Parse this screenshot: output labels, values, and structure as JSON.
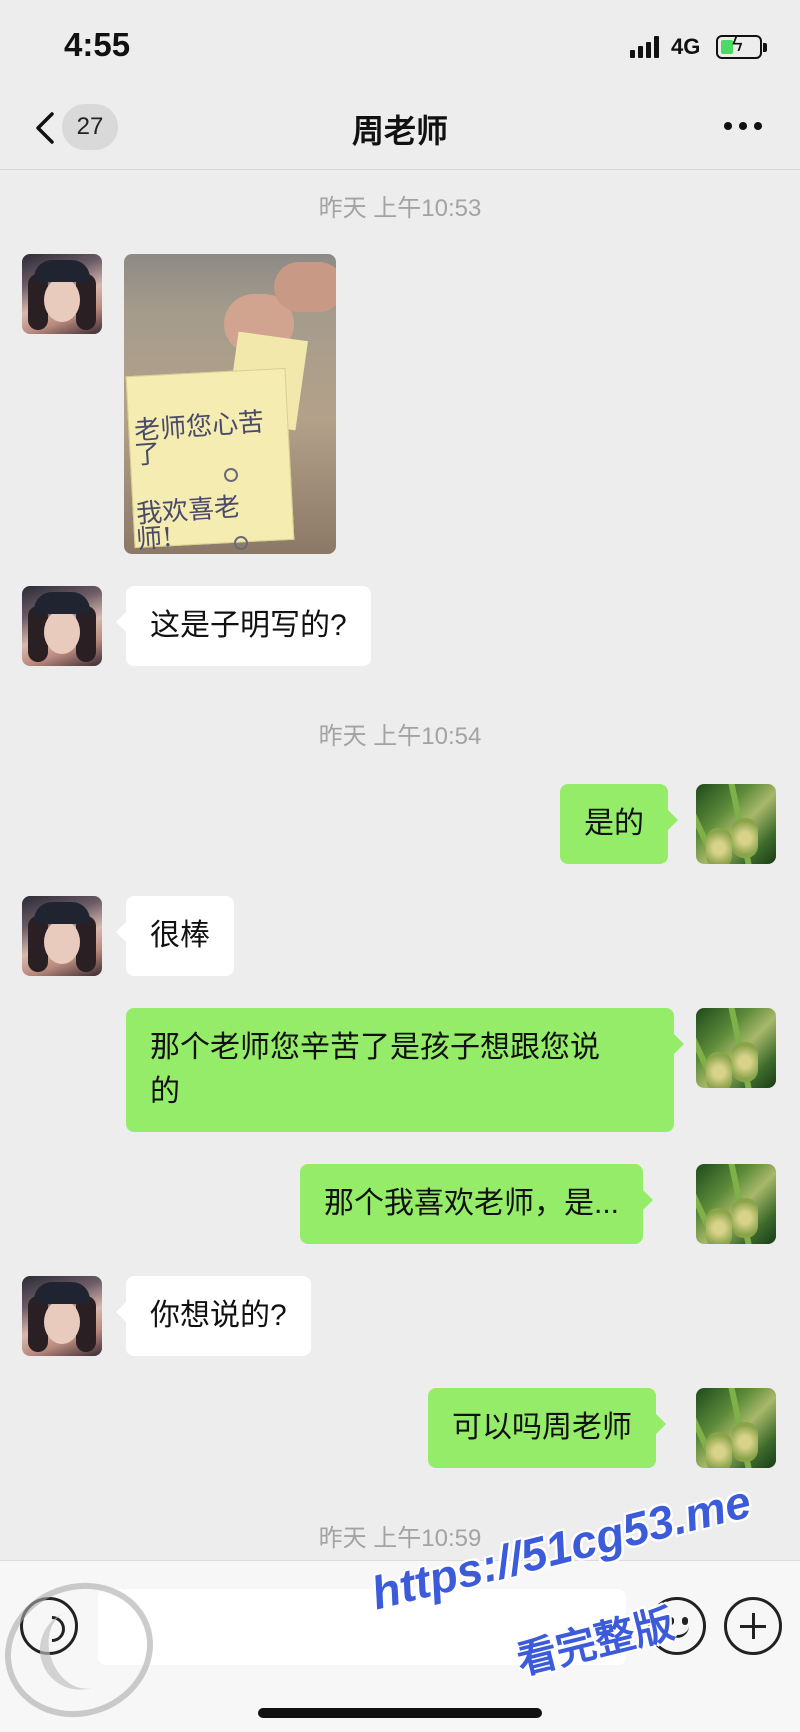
{
  "status_bar": {
    "time": "4:55",
    "network": "4G"
  },
  "nav": {
    "unread_count": "27",
    "title": "周老师"
  },
  "timestamps": [
    "昨天 上午10:53",
    "昨天 上午10:54",
    "昨天 上午10:59"
  ],
  "photo_note": {
    "line1": "老师您心苦",
    "line2": "了",
    "line3": "我欢喜老",
    "line4": "师!"
  },
  "messages": [
    {
      "side": "in",
      "text": "这是子明写的?"
    },
    {
      "side": "out",
      "text": "是的"
    },
    {
      "side": "in",
      "text": "很棒"
    },
    {
      "side": "out",
      "text_line1": "那个老师您辛苦了是孩子想跟您说",
      "text_line2": "的"
    },
    {
      "side": "out",
      "text": "那个我喜欢老师，是..."
    },
    {
      "side": "in",
      "text": "你想说的?"
    },
    {
      "side": "out",
      "text": "可以吗周老师"
    }
  ],
  "input": {
    "value": ""
  },
  "watermark": {
    "url": "https://51cg53.me",
    "sub": "看完整版"
  },
  "colors": {
    "background": "#ededed",
    "outgoing_bubble": "#95ec69",
    "incoming_bubble": "#ffffff",
    "watermark": "#3b5bdb"
  }
}
